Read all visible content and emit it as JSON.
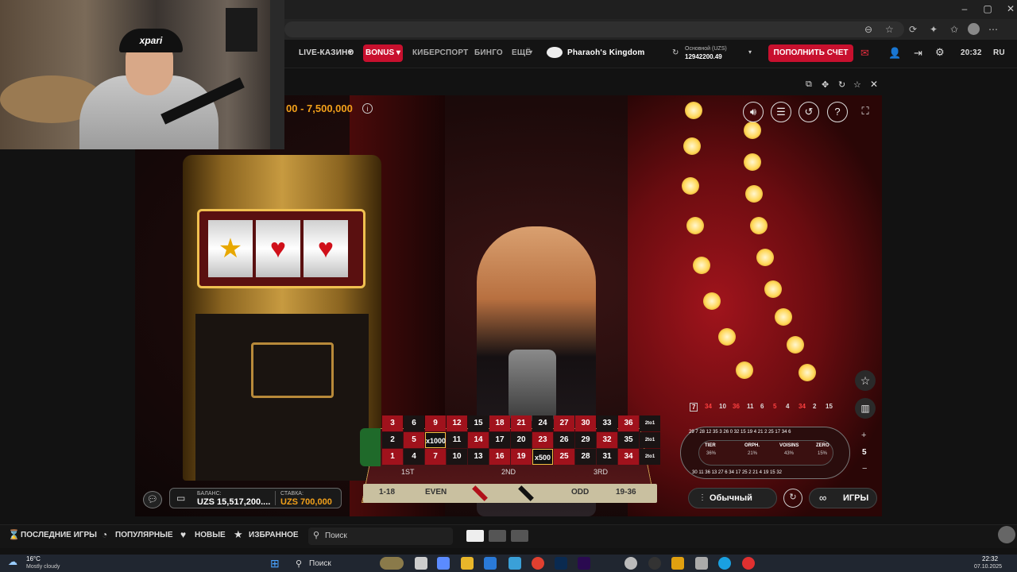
{
  "browser": {
    "window_controls": [
      "–",
      "▢",
      "✕"
    ]
  },
  "header": {
    "nav": [
      "LIVE-КАЗИНО",
      "BONUS",
      "КИБЕРСПОРТ",
      "БИНГО",
      "ЕЩЁ"
    ],
    "game_name": "Pharaoh's Kingdom",
    "account": {
      "label": "Основной (UZS)",
      "value": "12942200.49"
    },
    "deposit_label": "ПОПОЛНИТЬ СЧЕТ",
    "time": "20:32",
    "lang": "RU"
  },
  "webcam": {
    "cap_text": "xpari"
  },
  "game": {
    "limits": "00 - 7,500,000",
    "balance_label": "БАЛАНС:",
    "balance_value": "UZS 15,517,200....",
    "bet_label": "СТАВКА:",
    "bet_value": "UZS 700,000",
    "mode_label": "Обычный",
    "games_label": "ИГРЫ",
    "history": [
      "7",
      "34",
      "10",
      "36",
      "11",
      "6",
      "5",
      "4",
      "34",
      "2",
      "15"
    ],
    "table_rows": [
      [
        "3",
        "6",
        "9",
        "12",
        "15",
        "18",
        "21",
        "24",
        "27",
        "30",
        "33",
        "36"
      ],
      [
        "2",
        "5",
        "x1000",
        "11",
        "14",
        "17",
        "20",
        "23",
        "26",
        "29",
        "32",
        "35"
      ],
      [
        "1",
        "4",
        "7",
        "10",
        "13",
        "16",
        "19",
        "x500",
        "25",
        "28",
        "31",
        "34"
      ]
    ],
    "dozens": [
      "1ST",
      "2ND",
      "3RD"
    ],
    "outside": [
      "1-18",
      "EVEN",
      "",
      "",
      "ODD",
      "19-36"
    ],
    "column_label": "2to1",
    "race_sections": [
      "TIER",
      "ORPH.",
      "VOISINS",
      "ZERO"
    ],
    "race_pcts": [
      "36%",
      "21%",
      "43%",
      "15%"
    ],
    "race_neighbours": "5",
    "race_top": "29 7 28 12 35 3 26 0 32 15 19 4 21 2 25 17 34 6",
    "race_bottom": "30 11 36 13 27 6 34 17 25 2 21 4 19 15 32"
  },
  "footer": {
    "tabs": [
      "ПОСЛЕДНИЕ ИГРЫ",
      "ПОПУЛЯРНЫЕ",
      "НОВЫЕ",
      "ИЗБРАННОЕ"
    ],
    "search_placeholder": "Поиск"
  },
  "taskbar": {
    "weather_temp": "16°C",
    "weather_desc": "Mostly cloudy",
    "search": "Поиск",
    "clock_time": "22:32",
    "clock_date": "07.10.2025"
  },
  "colors": {
    "accent": "#c8102e",
    "gold": "#f2a01a",
    "felt": "#2a0d0d"
  }
}
